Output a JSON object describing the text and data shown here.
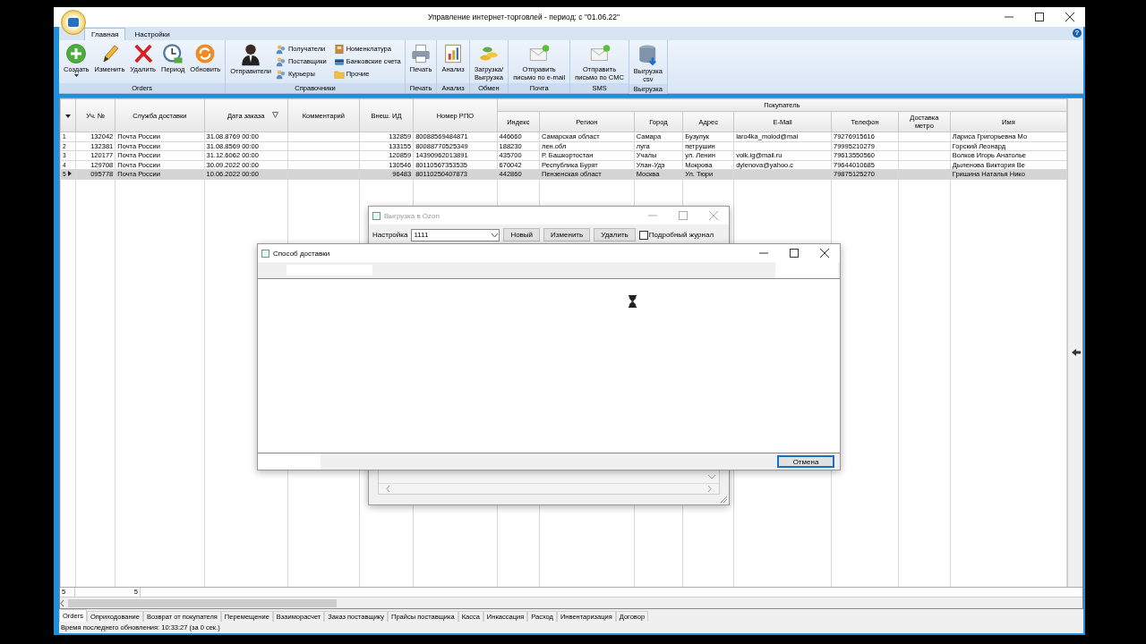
{
  "window": {
    "title": "Управление интернет-торговлей  - период: с \"01.06.22\""
  },
  "ribbon": {
    "tabs": [
      {
        "label": "Главная",
        "selected": true
      },
      {
        "label": "Настройки",
        "selected": false
      }
    ],
    "help": "?",
    "groups": [
      {
        "label": "Orders",
        "buttons": [
          {
            "label": "Создать",
            "kind": "large",
            "has_menu": true
          },
          {
            "label": "Изменить",
            "kind": "large",
            "has_menu": false
          },
          {
            "label": "Удалить",
            "kind": "large",
            "has_menu": false
          },
          {
            "label": "Период",
            "kind": "large",
            "has_menu": false
          },
          {
            "label": "Обновить",
            "kind": "large",
            "has_menu": false
          }
        ]
      },
      {
        "label": "Справочники",
        "buttons": [
          {
            "label": "Отправители",
            "kind": "large",
            "has_menu": false
          },
          {
            "label": "Получатели",
            "kind": "small",
            "has_menu": false
          },
          {
            "label": "Поставщики",
            "kind": "small",
            "has_menu": false
          },
          {
            "label": "Курьеры",
            "kind": "small",
            "has_menu": false
          },
          {
            "label": "Номенклатура",
            "kind": "small",
            "has_menu": false
          },
          {
            "label": "Банковские счета",
            "kind": "small",
            "has_menu": false
          },
          {
            "label": "Прочие",
            "kind": "small",
            "has_menu": false
          }
        ]
      },
      {
        "label": "Печать",
        "buttons": [
          {
            "label": "Печать",
            "kind": "large",
            "has_menu": false
          }
        ]
      },
      {
        "label": "Анализ",
        "buttons": [
          {
            "label": "Анализ",
            "kind": "large",
            "has_menu": false
          }
        ]
      },
      {
        "label": "Обмен",
        "buttons": [
          {
            "label": "Загрузка/\nВыгрузка",
            "kind": "large",
            "has_menu": false
          }
        ]
      },
      {
        "label": "Почта",
        "buttons": [
          {
            "label": "Отправить\nписьмо по e-mail",
            "kind": "large",
            "has_menu": false
          }
        ]
      },
      {
        "label": "SMS",
        "buttons": [
          {
            "label": "Отправить\nписьмо по СМС",
            "kind": "large",
            "has_menu": false
          }
        ]
      },
      {
        "label": "Выгрузка",
        "buttons": [
          {
            "label": "Выгрузка\ncsv",
            "kind": "large",
            "has_menu": false
          }
        ]
      }
    ]
  },
  "grid": {
    "columns": [
      {
        "label": "Уч. №",
        "filtered": false
      },
      {
        "label": "Служба доставки",
        "filtered": false
      },
      {
        "label": "Дата заказа",
        "filtered": true
      },
      {
        "label": "Комментарий",
        "filtered": false
      },
      {
        "label": "Внеш. ИД",
        "filtered": false
      },
      {
        "label": "Номер РПО",
        "filtered": false
      }
    ],
    "group": {
      "label": "Покупатель",
      "columns": [
        "Индекс",
        "Регион",
        "Город",
        "Адрес",
        "E-Mail",
        "Телефон",
        "Доставка\nметро",
        "Имя"
      ]
    },
    "rows": [
      {
        "number": "1",
        "selected": false,
        "cells": [
          "132042",
          "Почта России",
          "31.08.8769 00:00",
          null,
          "132859",
          "80088569484871",
          "446660",
          "Самарская област",
          "Самара",
          "Бузулук",
          "laro4ka_molod@mai",
          "79276915616",
          null,
          "Лариса Григорьевна Мо"
        ]
      },
      {
        "number": "2",
        "selected": false,
        "cells": [
          "132381",
          "Почта России",
          "31.08.8569 00:00",
          null,
          "133155",
          "80088770525349",
          "188230",
          "лен.обл",
          "луга",
          "петрушин",
          null,
          "79995210279",
          null,
          "Горский Леонард"
        ]
      },
      {
        "number": "3",
        "selected": false,
        "cells": [
          "120177",
          "Почта России",
          "31.12.6062 00:00",
          null,
          "120859",
          "14390962013891",
          "435700",
          "Р. Башкортостан",
          "Учалы",
          "ул. Ленин",
          "volk.ig@mail.ru",
          "79613550560",
          null,
          "Волков Игорь Анатолье"
        ]
      },
      {
        "number": "4",
        "selected": false,
        "cells": [
          "129708",
          "Почта России",
          "30.09.2022 00:00",
          null,
          "130546",
          "80110567353535",
          "670042",
          "Республика Бурят",
          "Улан-Удэ",
          "Мокрова",
          "dylenova@yahoo.c",
          "79644010685",
          null,
          "Дыленова Виктория Ве"
        ]
      },
      {
        "number": "5",
        "selected": true,
        "cells": [
          "095778",
          "Почта России",
          "10.06.2022 00:00",
          null,
          "96483",
          "80110250407873",
          "442860",
          "Пензенская област",
          "Москва",
          "Ул. Тюри",
          null,
          "79875125270",
          null,
          "Гришина Наталья Нико"
        ]
      }
    ],
    "footer": {
      "number": "5",
      "count": "5"
    }
  },
  "bottom_tabs": [
    {
      "label": "Orders",
      "selected": true
    },
    {
      "label": "Оприходование",
      "selected": false
    },
    {
      "label": "Возврат от покупателя",
      "selected": false
    },
    {
      "label": "Перемещение",
      "selected": false
    },
    {
      "label": "Взаиморасчет",
      "selected": false
    },
    {
      "label": "Заказ поставщику",
      "selected": false
    },
    {
      "label": "Прайсы поставщика",
      "selected": false
    },
    {
      "label": "Касса",
      "selected": false
    },
    {
      "label": "Инкассация",
      "selected": false
    },
    {
      "label": "Расход",
      "selected": false
    },
    {
      "label": "Инвентаризация",
      "selected": false
    },
    {
      "label": "Договор",
      "selected": false
    }
  ],
  "status_bar": "Время последнего обновления: 10:33:27 (за 0 сек.)",
  "ozon_dialog": {
    "title": "Выгрузка в Ozon",
    "setting_label": "Настройка",
    "setting_value": "1111",
    "buttons": [
      "Новый",
      "Изменить",
      "Удалить"
    ],
    "verbose_log": {
      "label": "Подробный журнал",
      "checked": false
    }
  },
  "delivery_dialog": {
    "title": "Способ доставки",
    "cancel": "Отмена"
  }
}
